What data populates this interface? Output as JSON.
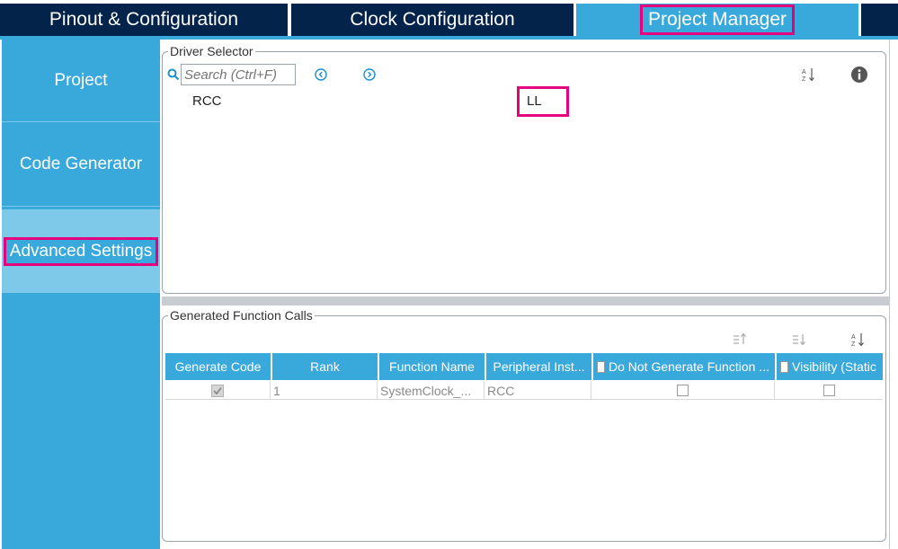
{
  "tabs": [
    {
      "label": "Pinout & Configuration",
      "active": false
    },
    {
      "label": "Clock Configuration",
      "active": false
    },
    {
      "label": "Project Manager",
      "active": true
    }
  ],
  "sidebar": {
    "items": [
      {
        "label": "Project",
        "active": false
      },
      {
        "label": "Code Generator",
        "active": false
      },
      {
        "label": "Advanced Settings",
        "active": true
      }
    ]
  },
  "driver_selector": {
    "title": "Driver Selector",
    "search_placeholder": "Search (Ctrl+F)",
    "rows": [
      {
        "peripheral": "RCC",
        "driver": "LL"
      }
    ]
  },
  "generated_calls": {
    "title": "Generated Function Calls",
    "columns": [
      "Generate Code",
      "Rank",
      "Function Name",
      "Peripheral Inst...",
      "Do Not Generate Function ...",
      "Visibility (Static"
    ],
    "rows": [
      {
        "generate_code": true,
        "rank": "1",
        "function_name": "SystemClock_...",
        "peripheral": "RCC",
        "do_not_generate": false,
        "visibility": false
      }
    ]
  },
  "icons": {
    "search": "search-icon",
    "prev": "chevron-left-circle-icon",
    "next": "chevron-right-circle-icon",
    "sort_az": "sort-az-icon",
    "info": "info-icon",
    "move_up": "move-up-icon",
    "move_down": "move-down-icon"
  },
  "colors": {
    "tab_dark": "#03234b",
    "accent": "#39a9dc",
    "highlight": "#e5007e"
  }
}
